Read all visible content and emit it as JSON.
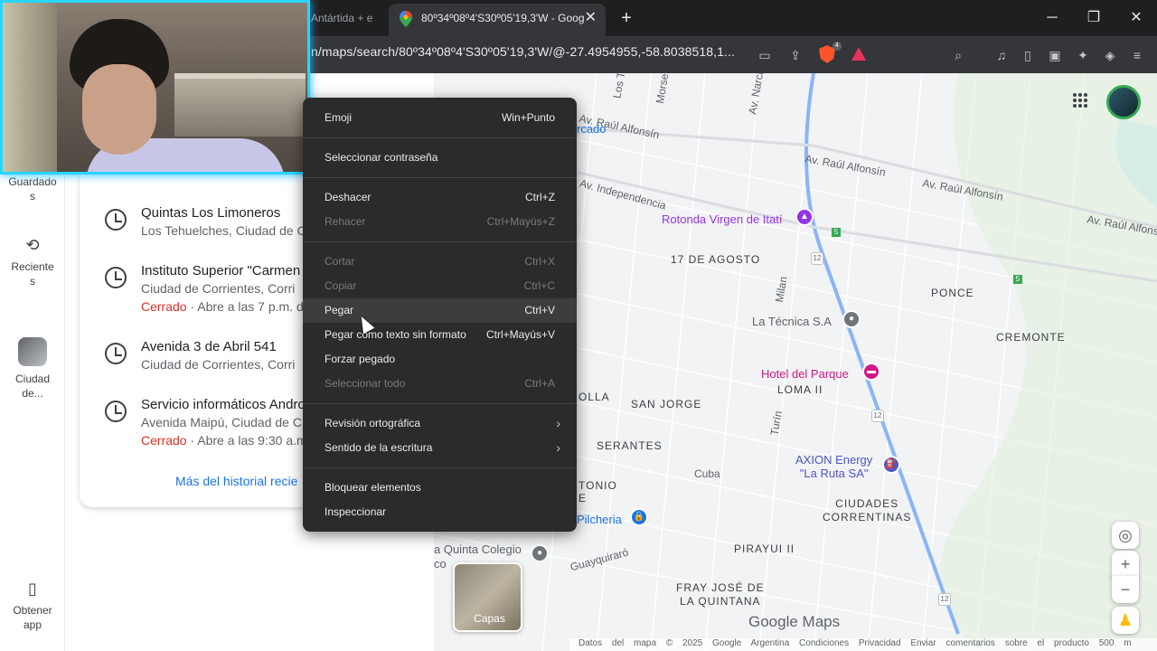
{
  "browser": {
    "tabs": [
      {
        "label": "Antártida + e"
      },
      {
        "label": "80º34º08º4'S30º05'19,3'W - Goog",
        "close": "✕"
      }
    ],
    "new_tab": "+",
    "window": {
      "minimize": "─",
      "restore": "❐",
      "close": "✕"
    },
    "url": "n/maps/search/80º34º08º4'S30º05'19,3'W/@-27.4954955,-58.8038518,1...",
    "brave_badge": "4",
    "accent": "#27d5ff"
  },
  "rail": {
    "items": [
      {
        "label": "Guardado\ns",
        "icon": "bookmark-icon"
      },
      {
        "label": "Reciente\ns",
        "icon": "history-icon"
      },
      {
        "label": "Ciudad\nde...",
        "icon": "city-thumbnail"
      },
      {
        "label": "Obtener\napp",
        "icon": "phone-icon"
      }
    ]
  },
  "history": {
    "items": [
      {
        "title": "Quintas Los Limoneros",
        "subtitle": "Los Tehuelches, Ciudad de C",
        "status_closed": "",
        "status_rest": ""
      },
      {
        "title": "Instituto Superior \"Carmen",
        "subtitle": "Ciudad de Corrientes, Corri",
        "status_closed": "Cerrado",
        "status_rest": " · Abre a las 7 p.m. d"
      },
      {
        "title": "Avenida 3 de Abril 541",
        "subtitle": "Ciudad de Corrientes, Corri",
        "status_closed": "",
        "status_rest": ""
      },
      {
        "title": "Servicio informáticos Andro",
        "subtitle": "Avenida Maipú, Ciudad de C",
        "status_closed": "Cerrado",
        "status_rest": " · Abre a las 9:30 a.m"
      }
    ],
    "more_link": "Más del historial recie"
  },
  "context_menu": {
    "items": [
      {
        "label": "Emoji",
        "shortcut": "Win+Punto",
        "disabled": false
      },
      {
        "label": "Seleccionar contraseña",
        "shortcut": "",
        "disabled": false
      },
      {
        "label": "Deshacer",
        "shortcut": "Ctrl+Z",
        "disabled": false
      },
      {
        "label": "Rehacer",
        "shortcut": "Ctrl+Mayús+Z",
        "disabled": true
      },
      {
        "label": "Cortar",
        "shortcut": "Ctrl+X",
        "disabled": true
      },
      {
        "label": "Copiar",
        "shortcut": "Ctrl+C",
        "disabled": true
      },
      {
        "label": "Pegar",
        "shortcut": "Ctrl+V",
        "disabled": false
      },
      {
        "label": "Pegar como texto sin formato",
        "shortcut": "Ctrl+Mayús+V",
        "disabled": false
      },
      {
        "label": "Forzar pegado",
        "shortcut": "",
        "disabled": false
      },
      {
        "label": "Seleccionar todo",
        "shortcut": "Ctrl+A",
        "disabled": true
      },
      {
        "label": "Revisión ortográfica",
        "shortcut": "›",
        "disabled": false
      },
      {
        "label": "Sentido de la escritura",
        "shortcut": "›",
        "disabled": false
      },
      {
        "label": "Bloquear elementos",
        "shortcut": "",
        "disabled": false
      },
      {
        "label": "Inspeccionar",
        "shortcut": "",
        "disabled": false
      }
    ]
  },
  "map": {
    "streets": [
      "Av. Raúl Alfonsín",
      "Av. Raúl Alfonsín",
      "Av. Raúl Alfonsín",
      "Av. Raúl Alfonsín",
      "Av. Independencia",
      "Milan",
      "Turín",
      "Cuba",
      "Guayquiraró",
      "Los T",
      "Morse",
      "Av. Narcis"
    ],
    "districts": [
      "17 DE AGOSTO",
      "PONCE",
      "CREMONTE",
      "LOMA II",
      "OLLA",
      "SAN JORGE",
      "SERANTES",
      "TONIO",
      "E",
      "CIUDADES\nCORRENTINAS",
      "PIRAYUI II",
      "FRAY JOSÉ DE\nLA QUINTANA"
    ],
    "pois": [
      {
        "name": "Rotonda Virgen de Itatí",
        "color": "#9334e6"
      },
      {
        "name": "La Técnica S.A",
        "color": "#5f6368"
      },
      {
        "name": "Hotel del Parque",
        "color": "#d01884"
      },
      {
        "name": "AXION Energy\n\"La Ruta SA\"",
        "color": "#4e55c6"
      },
      {
        "name": "Pilcheria",
        "color": "#1a73e8"
      },
      {
        "name": "a Quinta Colegio\nco",
        "color": "#5f6368"
      },
      {
        "name": "rcado",
        "color": "#1a73e8"
      }
    ],
    "route_numbers": [
      "12",
      "12",
      "12"
    ],
    "green_markers": [
      "5",
      "5"
    ],
    "layers_label": "Capas",
    "logo": "Google Maps",
    "footer": "Datos del mapa © 2025 Google   Argentina   Condiciones   Privacidad   Enviar comentarios sobre el producto   500 m"
  }
}
